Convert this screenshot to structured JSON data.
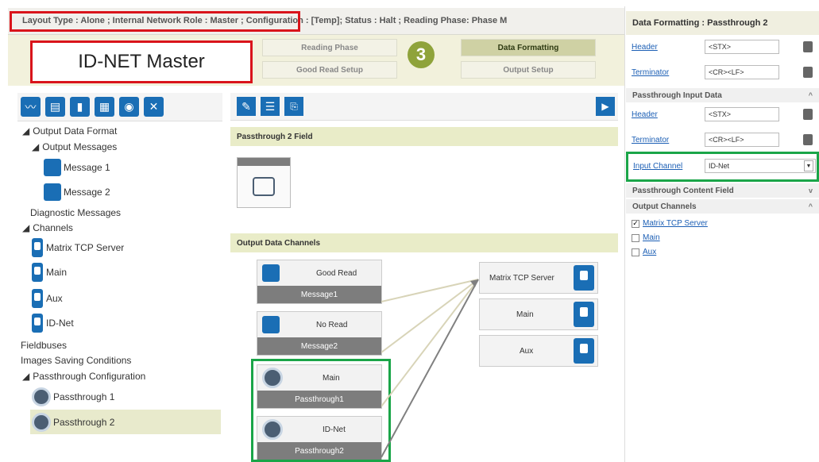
{
  "topbar": {
    "text": "Layout Type : Alone ; Internal Network Role : Master ; Configuration : [Temp]; Status : Halt ; Reading Phase: Phase M"
  },
  "device": {
    "label": "ID-NET Master"
  },
  "nav": {
    "reading_phase": "Reading Phase",
    "good_read_setup": "Good Read Setup",
    "data_formatting": "Data Formatting",
    "output_setup": "Output Setup",
    "step": "3"
  },
  "tree": {
    "output_data_format": "Output Data Format",
    "output_messages": "Output Messages",
    "message1": "Message 1",
    "message2": "Message 2",
    "diagnostic_messages": "Diagnostic Messages",
    "channels": "Channels",
    "matrix_tcp_server": "Matrix TCP Server",
    "main": "Main",
    "aux": "Aux",
    "id_net": "ID-Net",
    "fieldbuses": "Fieldbuses",
    "images_saving": "Images Saving Conditions",
    "passthrough_config": "Passthrough Configuration",
    "passthrough1": "Passthrough 1",
    "passthrough2": "Passthrough 2"
  },
  "center": {
    "passthrough2_field": "Passthrough 2 Field",
    "output_data_channels": "Output Data Channels",
    "messages": [
      {
        "top": "Good Read",
        "bottom": "Message1"
      },
      {
        "top": "No Read",
        "bottom": "Message2"
      },
      {
        "top": "Main",
        "bottom": "Passthrough1"
      },
      {
        "top": "ID-Net",
        "bottom": "Passthrough2"
      }
    ],
    "outputs": [
      "Matrix TCP Server",
      "Main",
      "Aux"
    ]
  },
  "right": {
    "title": "Data Formatting : Passthrough 2",
    "header_label": "Header",
    "header_value": "<STX>",
    "terminator_label": "Terminator",
    "terminator_value": "<CR><LF>",
    "passthrough_input_data": "Passthrough Input Data",
    "input_channel_label": "Input Channel",
    "input_channel_value": "ID-Net",
    "passthrough_content_field": "Passthrough Content Field",
    "output_channels": "Output Channels",
    "channels": [
      {
        "label": "Matrix TCP Server",
        "checked": true
      },
      {
        "label": "Main",
        "checked": false
      },
      {
        "label": "Aux",
        "checked": false
      }
    ]
  }
}
